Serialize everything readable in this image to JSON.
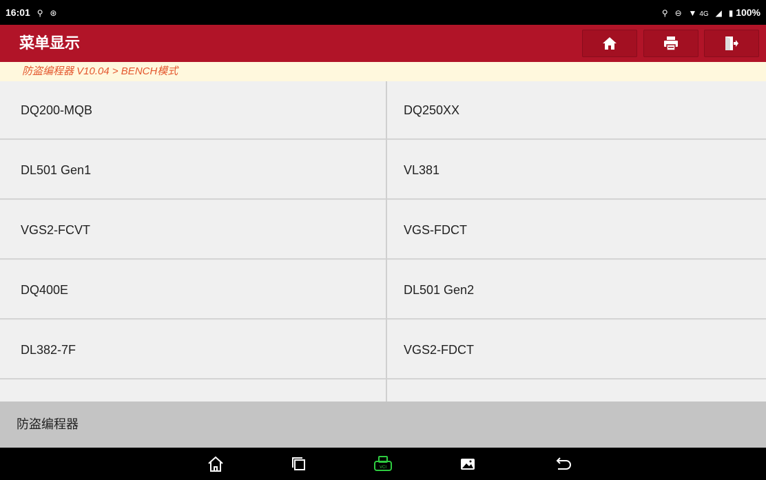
{
  "status": {
    "time": "16:01",
    "network": "4G",
    "battery": "100%"
  },
  "header": {
    "title": "菜单显示"
  },
  "breadcrumb": {
    "text": "防盗编程器 V10.04 > BENCH模式"
  },
  "items": [
    {
      "left": "DQ200-MQB",
      "right": "DQ250XX"
    },
    {
      "left": "DL501 Gen1",
      "right": "VL381"
    },
    {
      "left": "VGS2-FCVT",
      "right": "VGS-FDCT"
    },
    {
      "left": "DQ400E",
      "right": "DL501 Gen2"
    },
    {
      "left": "DL382-7F",
      "right": "VGS2-FDCT"
    }
  ],
  "footer": {
    "text": "防盗编程器"
  },
  "colors": {
    "titlebar": "#b11428",
    "breadcrumb": "#e4572e",
    "vci": "#2ecc40"
  }
}
